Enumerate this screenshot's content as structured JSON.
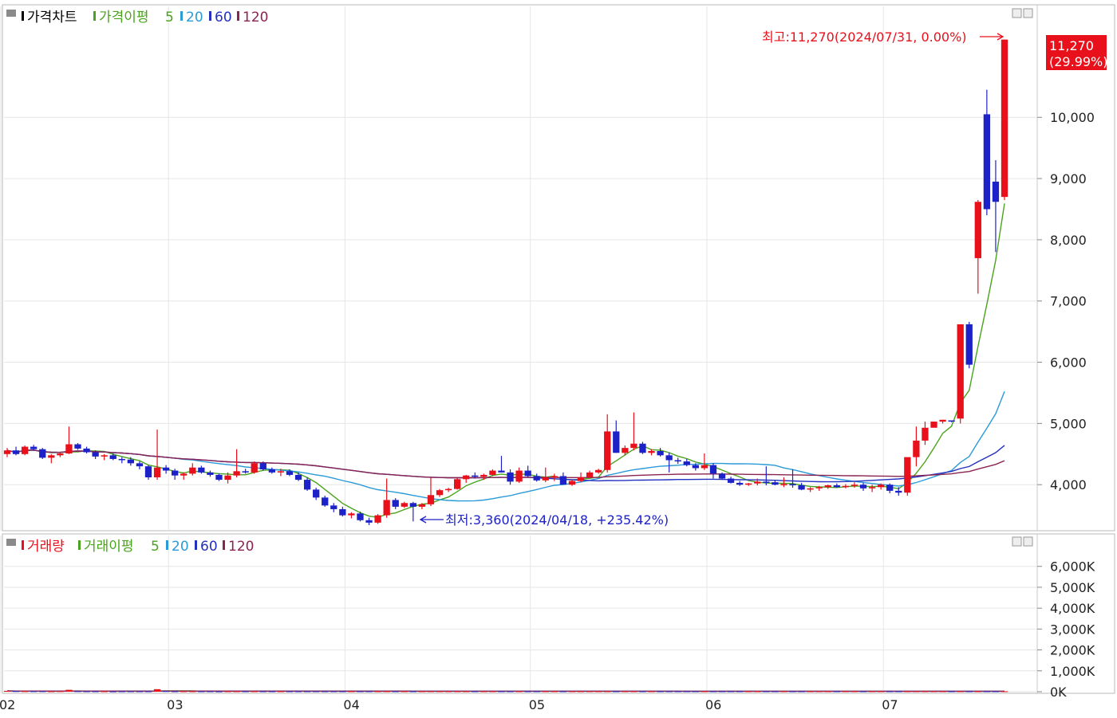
{
  "price_panel": {
    "legend": {
      "title": "가격차트",
      "ma_label": "가격이평",
      "periods": [
        "5",
        "20",
        "60",
        "120"
      ]
    },
    "high_annotation": "최고:11,270(2024/07/31, 0.00%)",
    "low_annotation": "최저:3,360(2024/04/18, +235.42%)",
    "current_price": "11,270",
    "current_change": "(29.99%)"
  },
  "volume_panel": {
    "legend": {
      "title": "거래량",
      "ma_label": "거래이평",
      "periods": [
        "5",
        "20",
        "60",
        "120"
      ]
    }
  },
  "colors": {
    "up": "#e8101a",
    "down": "#1d22c8",
    "ma5": "#4aa31c",
    "ma20": "#2a9ad8",
    "ma60": "#2430c0",
    "ma120": "#8a2350",
    "grid": "#e6e6e6"
  },
  "chart_data": [
    {
      "type": "candlestick",
      "yticks": [
        4000,
        5000,
        6000,
        7000,
        8000,
        9000,
        10000
      ],
      "ytick_labels": [
        "4,000",
        "5,000",
        "6,000",
        "7,000",
        "8,000",
        "9,000",
        "10,000"
      ],
      "ylim": [
        3300,
        11500
      ],
      "xticks": [
        {
          "label": "02",
          "index": 0
        },
        {
          "label": "03",
          "index": 19
        },
        {
          "label": "04",
          "index": 39
        },
        {
          "label": "05",
          "index": 60
        },
        {
          "label": "06",
          "index": 80
        },
        {
          "label": "07",
          "index": 100
        }
      ],
      "candles": [
        [
          4500,
          4600,
          4450,
          4560
        ],
        [
          4560,
          4620,
          4480,
          4500
        ],
        [
          4500,
          4640,
          4480,
          4620
        ],
        [
          4620,
          4650,
          4560,
          4580
        ],
        [
          4580,
          4600,
          4420,
          4440
        ],
        [
          4440,
          4500,
          4350,
          4480
        ],
        [
          4480,
          4540,
          4450,
          4510
        ],
        [
          4510,
          4950,
          4500,
          4660
        ],
        [
          4660,
          4680,
          4570,
          4590
        ],
        [
          4590,
          4620,
          4510,
          4530
        ],
        [
          4530,
          4560,
          4420,
          4460
        ],
        [
          4460,
          4500,
          4400,
          4480
        ],
        [
          4480,
          4510,
          4400,
          4420
        ],
        [
          4420,
          4450,
          4350,
          4410
        ],
        [
          4410,
          4450,
          4310,
          4350
        ],
        [
          4350,
          4380,
          4250,
          4300
        ],
        [
          4300,
          4320,
          4080,
          4120
        ],
        [
          4120,
          4900,
          4080,
          4280
        ],
        [
          4280,
          4320,
          4180,
          4230
        ],
        [
          4230,
          4260,
          4080,
          4150
        ],
        [
          4150,
          4200,
          4080,
          4180
        ],
        [
          4180,
          4350,
          4150,
          4280
        ],
        [
          4280,
          4310,
          4180,
          4200
        ],
        [
          4200,
          4230,
          4130,
          4160
        ],
        [
          4160,
          4180,
          4060,
          4080
        ],
        [
          4080,
          4200,
          4020,
          4150
        ],
        [
          4150,
          4580,
          4120,
          4220
        ],
        [
          4220,
          4260,
          4180,
          4200
        ],
        [
          4200,
          4380,
          4180,
          4350
        ],
        [
          4350,
          4380,
          4230,
          4250
        ],
        [
          4250,
          4280,
          4180,
          4200
        ],
        [
          4200,
          4260,
          4140,
          4220
        ],
        [
          4220,
          4250,
          4140,
          4160
        ],
        [
          4160,
          4200,
          4060,
          4080
        ],
        [
          4080,
          4120,
          3900,
          3920
        ],
        [
          3920,
          3950,
          3750,
          3790
        ],
        [
          3790,
          3820,
          3640,
          3660
        ],
        [
          3660,
          3700,
          3550,
          3600
        ],
        [
          3600,
          3640,
          3480,
          3500
        ],
        [
          3500,
          3550,
          3450,
          3530
        ],
        [
          3530,
          3560,
          3400,
          3420
        ],
        [
          3420,
          3460,
          3340,
          3380
        ],
        [
          3380,
          3520,
          3360,
          3500
        ],
        [
          3500,
          4100,
          3460,
          3750
        ],
        [
          3750,
          3780,
          3600,
          3640
        ],
        [
          3640,
          3720,
          3620,
          3700
        ],
        [
          3700,
          3720,
          3400,
          3640
        ],
        [
          3640,
          3700,
          3600,
          3680
        ],
        [
          3680,
          4120,
          3650,
          3830
        ],
        [
          3830,
          3930,
          3800,
          3910
        ],
        [
          3910,
          3950,
          3880,
          3930
        ],
        [
          3930,
          4120,
          3920,
          4090
        ],
        [
          4090,
          4160,
          4030,
          4150
        ],
        [
          4150,
          4200,
          4100,
          4130
        ],
        [
          4130,
          4180,
          4080,
          4160
        ],
        [
          4160,
          4250,
          4140,
          4230
        ],
        [
          4230,
          4470,
          4200,
          4200
        ],
        [
          4200,
          4250,
          4000,
          4050
        ],
        [
          4050,
          4280,
          4030,
          4230
        ],
        [
          4230,
          4310,
          4120,
          4140
        ],
        [
          4140,
          4180,
          4050,
          4070
        ],
        [
          4070,
          4280,
          4040,
          4120
        ],
        [
          4120,
          4180,
          4060,
          4140
        ],
        [
          4140,
          4200,
          4080,
          4000
        ],
        [
          4000,
          4080,
          3980,
          4060
        ],
        [
          4060,
          4200,
          4040,
          4120
        ],
        [
          4120,
          4230,
          4100,
          4200
        ],
        [
          4200,
          4260,
          4180,
          4240
        ],
        [
          4240,
          5150,
          4200,
          4870
        ],
        [
          4870,
          5050,
          4520,
          4520
        ],
        [
          4520,
          4640,
          4480,
          4600
        ],
        [
          4600,
          5180,
          4560,
          4670
        ],
        [
          4670,
          4700,
          4500,
          4520
        ],
        [
          4520,
          4580,
          4480,
          4550
        ],
        [
          4550,
          4600,
          4460,
          4480
        ],
        [
          4480,
          4520,
          4200,
          4400
        ],
        [
          4400,
          4440,
          4340,
          4380
        ],
        [
          4380,
          4420,
          4300,
          4320
        ],
        [
          4320,
          4350,
          4230,
          4270
        ],
        [
          4270,
          4510,
          4240,
          4320
        ],
        [
          4320,
          4350,
          4100,
          4180
        ],
        [
          4180,
          4200,
          4080,
          4100
        ],
        [
          4100,
          4130,
          4020,
          4030
        ],
        [
          4030,
          4060,
          3980,
          4000
        ],
        [
          4000,
          4030,
          3980,
          4020
        ],
        [
          4020,
          4100,
          3990,
          4050
        ],
        [
          4050,
          4300,
          3990,
          4040
        ],
        [
          4040,
          4070,
          3990,
          4000
        ],
        [
          4000,
          4120,
          3960,
          4010
        ],
        [
          4010,
          4250,
          3950,
          3990
        ],
        [
          3990,
          4030,
          3910,
          3920
        ],
        [
          3920,
          3960,
          3880,
          3940
        ],
        [
          3940,
          3980,
          3900,
          3960
        ],
        [
          3960,
          4000,
          3930,
          3990
        ],
        [
          3990,
          4020,
          3950,
          3960
        ],
        [
          3960,
          4010,
          3940,
          3980
        ],
        [
          3980,
          4040,
          3950,
          4000
        ],
        [
          4000,
          4030,
          3900,
          3940
        ],
        [
          3940,
          4000,
          3880,
          3960
        ],
        [
          3960,
          4020,
          3920,
          4000
        ],
        [
          4000,
          4020,
          3860,
          3900
        ],
        [
          3900,
          3960,
          3820,
          3870
        ],
        [
          3870,
          4100,
          3820,
          4450
        ],
        [
          4450,
          4950,
          4300,
          4720
        ],
        [
          4720,
          5030,
          4650,
          4930
        ],
        [
          4930,
          5030,
          4950,
          5030
        ],
        [
          5030,
          5060,
          5000,
          5060
        ],
        [
          5050,
          5040,
          5020,
          5040
        ],
        [
          5080,
          5900,
          5000,
          6620
        ],
        [
          6620,
          6660,
          5900,
          5960
        ],
        [
          7700,
          8650,
          7120,
          8620
        ],
        [
          10050,
          10450,
          8400,
          8500
        ],
        [
          8950,
          9300,
          7800,
          8620
        ],
        [
          8700,
          11270,
          8650,
          11270
        ]
      ]
    },
    {
      "type": "bar",
      "yticks": [
        0,
        1000,
        2000,
        3000,
        4000,
        5000,
        6000
      ],
      "ytick_labels": [
        "0K",
        "1,000K",
        "2,000K",
        "3,000K",
        "4,000K",
        "5,000K",
        "6,000K"
      ],
      "ylim": [
        0,
        6600
      ],
      "values": [
        40,
        30,
        25,
        25,
        25,
        20,
        25,
        90,
        25,
        20,
        20,
        20,
        15,
        20,
        20,
        20,
        20,
        120,
        30,
        20,
        20,
        20,
        20,
        20,
        15,
        20,
        20,
        20,
        20,
        20,
        20,
        20,
        20,
        20,
        20,
        20,
        20,
        20,
        20,
        20,
        20,
        20,
        20,
        20,
        20,
        20,
        20,
        20,
        20,
        20,
        20,
        20,
        20,
        20,
        20,
        20,
        20,
        20,
        20,
        20,
        20,
        20,
        20,
        20,
        20,
        20,
        20,
        20,
        20,
        20,
        20,
        20,
        20,
        20,
        20,
        20,
        20,
        20,
        20,
        20,
        20,
        20,
        20,
        20,
        20,
        20,
        20,
        20,
        20,
        20,
        20,
        20,
        20,
        20,
        20,
        20,
        20,
        20,
        20,
        20,
        20,
        20,
        20,
        20,
        20,
        20,
        20,
        20,
        20,
        20,
        20,
        20,
        20,
        20,
        20,
        20,
        20,
        20,
        20,
        20,
        20,
        20,
        20,
        20,
        20,
        20,
        20,
        20,
        20,
        20,
        20,
        20,
        20,
        20,
        20,
        20,
        20,
        20,
        20,
        20,
        20,
        20,
        20,
        20,
        20,
        20,
        20,
        20,
        20,
        20,
        20,
        20,
        20,
        20,
        20,
        20,
        20,
        20,
        20,
        20,
        20,
        20,
        20,
        20,
        20,
        20,
        20,
        20,
        20,
        20,
        20,
        20,
        20,
        20,
        20,
        20,
        20,
        20,
        20,
        20,
        20,
        20,
        20,
        20,
        20,
        20,
        20,
        20,
        20,
        20,
        20,
        20,
        20,
        20,
        20,
        20,
        20,
        20,
        20,
        20,
        20,
        20,
        20,
        20,
        20,
        20,
        20,
        20,
        20,
        20,
        20,
        20,
        20,
        20,
        20,
        20,
        20,
        20,
        20,
        20,
        20,
        20,
        20,
        20,
        20,
        20,
        20,
        20,
        20,
        20,
        20,
        20,
        20,
        20,
        20,
        20,
        20,
        20,
        20,
        20,
        20,
        20,
        20,
        20,
        20,
        20,
        20,
        20,
        20,
        20,
        20,
        20,
        20,
        20,
        20,
        20,
        20,
        20,
        20,
        20,
        20,
        20,
        20,
        20,
        20,
        20,
        20,
        20,
        20,
        20,
        20,
        20,
        20,
        20,
        20,
        20,
        20,
        20,
        20,
        20,
        20,
        20,
        20,
        20,
        20,
        20,
        20,
        20,
        20,
        20,
        20,
        20,
        20,
        20,
        20,
        20,
        20,
        20,
        20,
        20,
        20,
        20,
        20,
        20,
        20,
        20,
        20,
        20,
        20,
        20,
        20,
        20,
        20,
        20,
        20,
        20,
        20,
        20,
        20,
        20,
        20,
        20,
        20,
        20,
        20,
        20,
        20,
        20,
        20,
        20,
        20,
        20,
        20,
        20,
        20,
        20,
        20,
        20,
        20,
        20,
        20,
        20,
        20,
        20,
        20,
        20,
        20,
        20,
        20,
        20,
        20,
        20,
        20,
        20,
        20,
        20,
        20,
        20,
        20,
        20,
        20,
        20,
        20,
        20,
        20,
        20,
        20,
        20,
        20,
        20,
        20,
        20,
        20,
        20,
        20,
        20,
        20,
        20,
        20,
        20,
        20,
        20,
        20,
        20,
        20,
        20,
        20,
        20,
        20,
        20,
        20,
        20,
        20,
        20,
        20,
        20,
        20,
        20,
        20,
        20
      ]
    }
  ]
}
